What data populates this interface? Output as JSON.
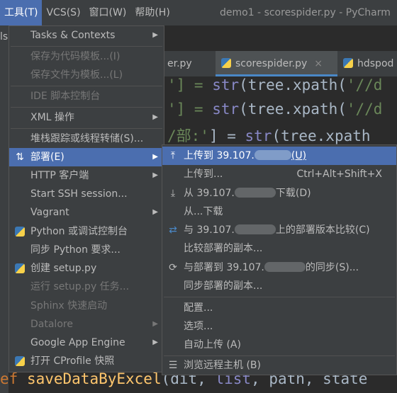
{
  "menubar": {
    "items": [
      {
        "label": "工具(T)",
        "active": true
      },
      {
        "label": "VCS(S)",
        "active": false
      },
      {
        "label": "窗口(W)",
        "active": false
      },
      {
        "label": "帮助(H)",
        "active": false
      }
    ],
    "window_title": "demo1 - scorespider.py - PyCharm",
    "left_sliver_text": "ls"
  },
  "tabs": [
    {
      "label": "er.py",
      "active": false
    },
    {
      "label": "scorespider.py",
      "active": true,
      "close": "×"
    },
    {
      "label": "hdspod",
      "active": false
    }
  ],
  "code": {
    "line1": [
      "'] = ",
      "str",
      "(tree.xpath(",
      "'//d"
    ],
    "line2": [
      "'] = ",
      "str",
      "(tree.xpath(",
      "'//d"
    ],
    "line3": [
      "/部:'",
      "] = ",
      "str",
      "(tree.xpath"
    ],
    "bottom": [
      "ef ",
      "saveDataByExcel",
      "(dit, ",
      "list",
      ", path, state"
    ]
  },
  "tools_menu": {
    "items": [
      {
        "label": "Tasks & Contexts",
        "submenu": true
      },
      {
        "label": "保存为代码模板...(I)",
        "disabled": true
      },
      {
        "label": "保存文件为模板...(L)",
        "disabled": true
      },
      {
        "label": "IDE 脚本控制台",
        "disabled": true
      },
      {
        "label": "XML 操作",
        "submenu": true
      },
      {
        "label": "堆栈跟踪或线程转储(S)..."
      },
      {
        "label": "部署(E)",
        "submenu": true,
        "selected": true
      },
      {
        "label": "HTTP 客户端",
        "submenu": true
      },
      {
        "label": "Start SSH session..."
      },
      {
        "label": "Vagrant",
        "submenu": true
      },
      {
        "label": "Python 或调试控制台"
      },
      {
        "label": "同步 Python 要求..."
      },
      {
        "label": "创建 setup.py"
      },
      {
        "label": "运行 setup.py 任务...",
        "disabled": true
      },
      {
        "label": "Sphinx 快速启动",
        "disabled": true
      },
      {
        "label": "Datalore",
        "submenu": true,
        "disabled": true
      },
      {
        "label": "Google App Engine",
        "submenu": true
      },
      {
        "label": "打开 CProfile 快照"
      }
    ]
  },
  "deploy_menu": {
    "upload_to_server": {
      "prefix": "上传到 39.107.",
      "suffix": "(U)"
    },
    "upload_to": {
      "label": "上传到...",
      "shortcut": "Ctrl+Alt+Shift+X"
    },
    "download_from_server": {
      "prefix": "从 39.107.",
      "suffix": "下载(D)"
    },
    "download_from": {
      "label": "从...下载"
    },
    "compare_with_server": {
      "prefix": "与 39.107.",
      "suffix": "上的部署版本比较(C)"
    },
    "compare_copies": {
      "label": "比较部署的副本..."
    },
    "sync_with_server": {
      "prefix": "与部署到 39.107.",
      "suffix": "的同步(S)..."
    },
    "sync_copies": {
      "label": "同步部署的副本..."
    },
    "configuration": {
      "label": "配置..."
    },
    "options": {
      "label": "选项..."
    },
    "auto_upload": {
      "label": "自动上传 (A)"
    },
    "browse_remote": {
      "label": "浏览远程主机 (B)"
    }
  },
  "icons": {
    "submenu_arrow": "▶",
    "deploy": "⇅",
    "upload": "⤒",
    "download": "⤓",
    "compare": "⇄",
    "sync": "⟳",
    "browse": "☰"
  },
  "colors": {
    "menu_bg": "#3c3f41",
    "selection": "#4b6eaf",
    "editor_bg": "#2b2b2b",
    "string": "#6a8759",
    "builtin": "#8888c6",
    "keyword": "#cc7832",
    "function": "#ffc66d"
  }
}
